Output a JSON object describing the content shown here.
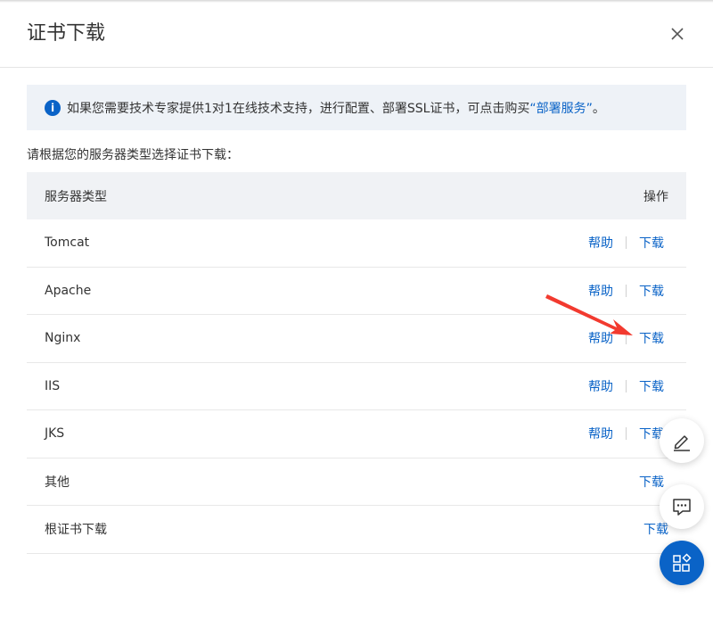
{
  "dialog": {
    "title": "证书下载"
  },
  "notice": {
    "text_before": "如果您需要技术专家提供1对1在线技术支持，进行配置、部署SSL证书，可点击购买",
    "link": "“部署服务”",
    "text_after": "。"
  },
  "section_label": "请根据您的服务器类型选择证书下载：",
  "table": {
    "header": {
      "server_type": "服务器类型",
      "action": "操作"
    },
    "rows": [
      {
        "name": "Tomcat",
        "help": "帮助",
        "download": "下载"
      },
      {
        "name": "Apache",
        "help": "帮助",
        "download": "下载"
      },
      {
        "name": "Nginx",
        "help": "帮助",
        "download": "下载"
      },
      {
        "name": "IIS",
        "help": "帮助",
        "download": "下载"
      },
      {
        "name": "JKS",
        "help": "帮助",
        "download": "下载"
      },
      {
        "name": "其他",
        "download": "下载"
      },
      {
        "name": "根证书下载",
        "download": "下载"
      }
    ]
  },
  "colors": {
    "accent": "#0a63c7",
    "arrow": "#f23a2f",
    "notice_bg": "#eef2f7",
    "header_bg": "#f0f2f5"
  },
  "floating_buttons": [
    "edit-icon",
    "chat-icon",
    "apps-icon"
  ]
}
